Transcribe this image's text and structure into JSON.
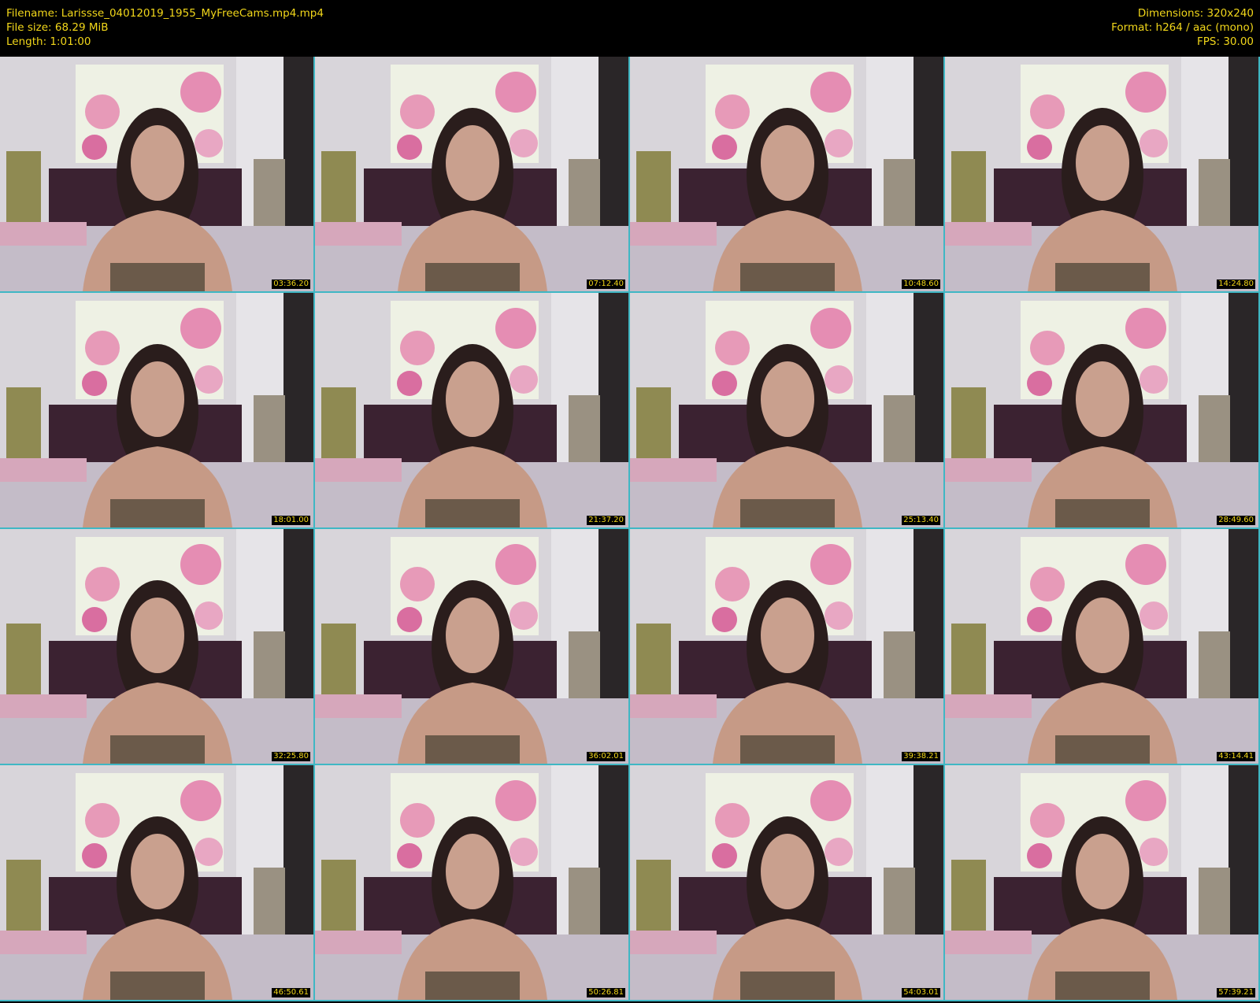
{
  "header": {
    "filename": "Filename: Larissse_04012019_1955_MyFreeCams.mp4.mp4",
    "filesize": "File size: 68.29 MiB",
    "length": "Length: 1:01:00",
    "dimensions": "Dimensions: 320x240",
    "format": "Format: h264 / aac (mono)",
    "fps": "FPS: 30.00"
  },
  "thumbnails": [
    {
      "timestamp": "03:36.20"
    },
    {
      "timestamp": "07:12.40"
    },
    {
      "timestamp": "10:48.60"
    },
    {
      "timestamp": "14:24.80"
    },
    {
      "timestamp": "18:01.00"
    },
    {
      "timestamp": "21:37.20"
    },
    {
      "timestamp": "25:13.40"
    },
    {
      "timestamp": "28:49.60"
    },
    {
      "timestamp": "32:25.80"
    },
    {
      "timestamp": "36:02.01"
    },
    {
      "timestamp": "39:38.21"
    },
    {
      "timestamp": "43:14.41"
    },
    {
      "timestamp": "46:50.61"
    },
    {
      "timestamp": "50:26.81"
    },
    {
      "timestamp": "54:03.01"
    },
    {
      "timestamp": "57:39.21"
    }
  ],
  "colors": {
    "header_text": "#f2d71a",
    "grid_separator": "#3fb7c4",
    "background": "#000000"
  }
}
